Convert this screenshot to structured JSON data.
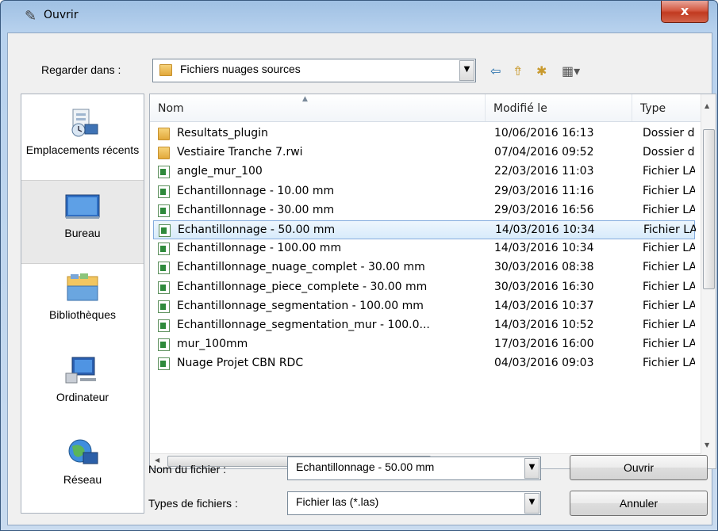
{
  "window": {
    "title": "Ouvrir",
    "close_label": "x"
  },
  "toolbar": {
    "look_in_label": "Regarder dans :",
    "look_in_value": "Fichiers nuages sources"
  },
  "places": [
    {
      "label": "Emplacements récents",
      "icon": "recent-places-icon"
    },
    {
      "label": "Bureau",
      "icon": "desktop-icon"
    },
    {
      "label": "Bibliothèques",
      "icon": "libraries-icon"
    },
    {
      "label": "Ordinateur",
      "icon": "computer-icon"
    },
    {
      "label": "Réseau",
      "icon": "network-icon"
    }
  ],
  "list": {
    "columns": {
      "name": "Nom",
      "modified": "Modifié le",
      "type": "Type"
    },
    "rows": [
      {
        "name": "Resultats_plugin",
        "modified": "10/06/2016 16:13",
        "type": "Dossier de fichiers",
        "kind": "folder"
      },
      {
        "name": "Vestiaire Tranche 7.rwi",
        "modified": "07/04/2016 09:52",
        "type": "Dossier de fichiers",
        "kind": "folder"
      },
      {
        "name": "angle_mur_100",
        "modified": "22/03/2016 11:03",
        "type": "Fichier LAS",
        "kind": "file"
      },
      {
        "name": "Echantillonnage - 10.00 mm",
        "modified": "29/03/2016 11:16",
        "type": "Fichier LAS",
        "kind": "file"
      },
      {
        "name": "Echantillonnage - 30.00 mm",
        "modified": "29/03/2016 16:56",
        "type": "Fichier LAS",
        "kind": "file"
      },
      {
        "name": "Echantillonnage - 50.00 mm",
        "modified": "14/03/2016 10:34",
        "type": "Fichier LAS",
        "kind": "file",
        "selected": true
      },
      {
        "name": "Echantillonnage - 100.00 mm",
        "modified": "14/03/2016 10:34",
        "type": "Fichier LAS",
        "kind": "file"
      },
      {
        "name": "Echantillonnage_nuage_complet - 30.00 mm",
        "modified": "30/03/2016 08:38",
        "type": "Fichier LAS",
        "kind": "file"
      },
      {
        "name": "Echantillonnage_piece_complete - 30.00 mm",
        "modified": "30/03/2016 16:30",
        "type": "Fichier LAS",
        "kind": "file"
      },
      {
        "name": "Echantillonnage_segmentation - 100.00 mm",
        "modified": "14/03/2016 10:37",
        "type": "Fichier LAS",
        "kind": "file"
      },
      {
        "name": "Echantillonnage_segmentation_mur - 100.0...",
        "modified": "14/03/2016 10:52",
        "type": "Fichier LAS",
        "kind": "file"
      },
      {
        "name": "mur_100mm",
        "modified": "17/03/2016 16:00",
        "type": "Fichier LAS",
        "kind": "file"
      },
      {
        "name": "Nuage Projet CBN RDC",
        "modified": "04/03/2016 09:03",
        "type": "Fichier LAS",
        "kind": "file"
      }
    ]
  },
  "footer": {
    "filename_label": "Nom du fichier :",
    "filename_value": "Echantillonnage - 50.00 mm",
    "filetype_label": "Types de fichiers :",
    "filetype_value": "Fichier las (*.las)",
    "open_label": "Ouvrir",
    "cancel_label": "Annuler"
  }
}
